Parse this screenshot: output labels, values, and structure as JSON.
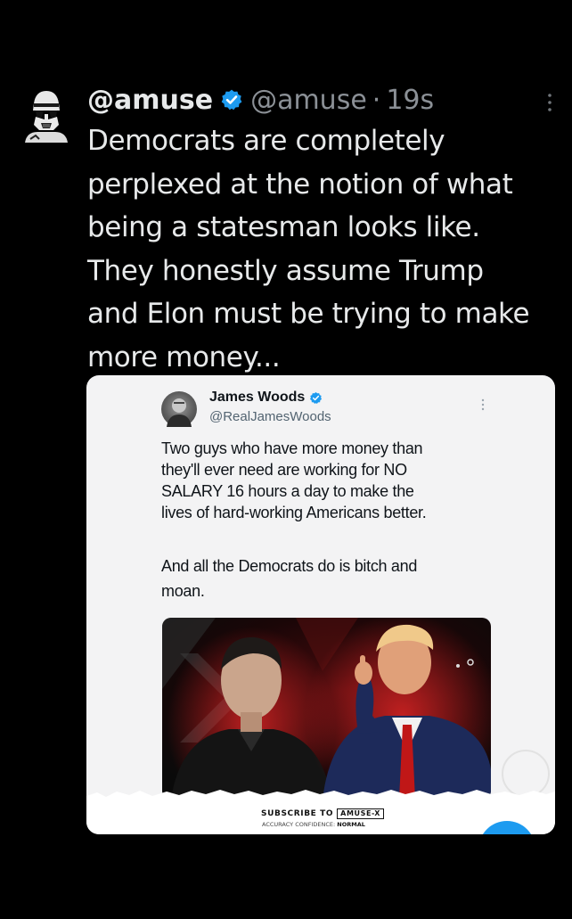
{
  "tweet": {
    "display_name": "@amuse",
    "handle": "@amuse",
    "separator": "·",
    "time": "19s",
    "avatar_icon": "stormtrooper-avatar-icon",
    "verified_icon": "verified-badge-icon",
    "more_icon": "more-vertical-icon",
    "text": "Democrats are completely\nperplexed at the notion of what\nbeing a statesman looks like.\nThey honestly assume Trump\nand Elon must be trying to make\nmore money..."
  },
  "quoted_image": {
    "display_name": "James Woods",
    "handle": "@RealJamesWoods",
    "paragraph1": "Two guys who have more money than\nthey'll ever need are working for NO\nSALARY 16 hours a day to make the\nlives of hard-working Americans better.",
    "paragraph2": "And all the Democrats do is bitch and\nmoan.",
    "photo_description_icon": "photo-two-men-icon",
    "footer": {
      "subscribe_label": "SUBSCRIBE TO",
      "brand": "AMUSE-X",
      "accuracy_label": "ACCURACY CONFIDENCE:",
      "accuracy_value": "NORMAL"
    }
  },
  "colors": {
    "background": "#000000",
    "text": "#e7e9ea",
    "muted": "#8b9096",
    "verified": "#1d9bf0",
    "card": "#f3f3f4"
  }
}
